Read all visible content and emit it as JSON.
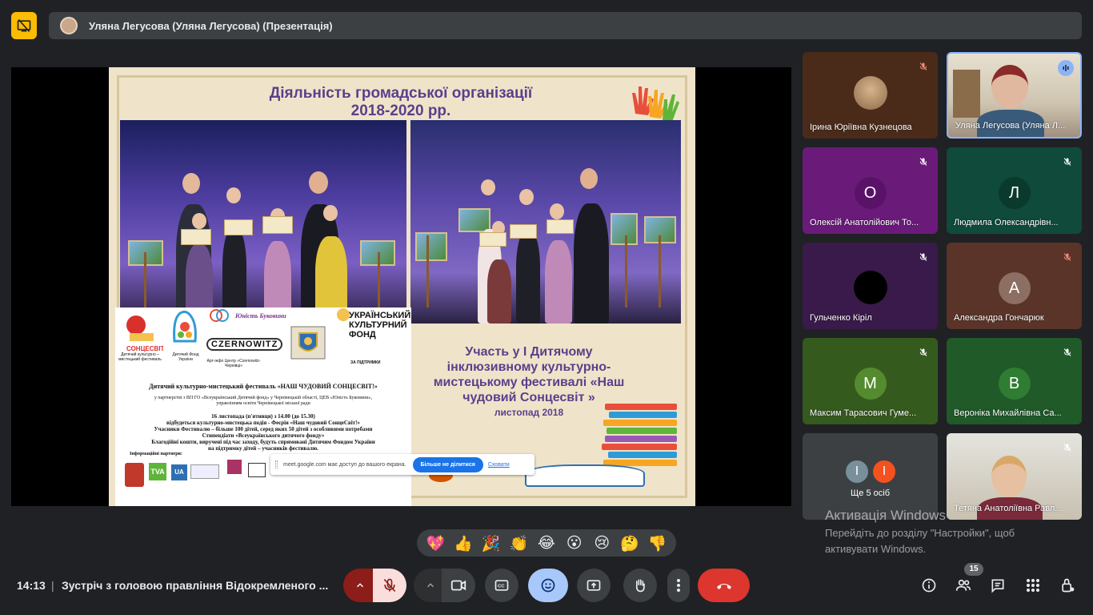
{
  "header": {
    "presenter_title": "Уляна Легусова (Уляна Легусова) (Презентація)"
  },
  "slide": {
    "title_line1": "Діяльність громадської організації",
    "title_line2": "2018-2020 рр.",
    "caption_line1": "Участь у І Дитячому",
    "caption_line2": "інклюзивному культурно-",
    "caption_line3": "мистецькому фестивалі «Наш",
    "caption_line4": "чудовий Сонцесвіт »",
    "caption_date": "листопад 2018",
    "flyer": {
      "logo1_caption": "Дитячий культурно – мистецький фестиваль",
      "logo2_caption": "Дитячий Фонд України",
      "logo3_caption": "Арт-інфо Центр «Czernowitz-Чернівці»",
      "cultural_fund": "УКРАЇНСЬКИЙ КУЛЬТУРНИЙ ФОНД",
      "support": "ЗА ПІДТРИМКИ",
      "unist_label": "Юність Буковини",
      "czernowitz": "CZERNOWITZ",
      "festival_title": "Дитячий культурно-мистецький фестиваль «НАШ ЧУДОВИЙ СОНЦЕСВІТ!»",
      "partners_line1": "у партнерстві з ВП ГО «Всеукраїнський Дитячий фонд» у Чернівецькій області, ЦЕВ «Юність Буковини»,",
      "partners_line2": "управлінням освіти Чернівецької міської ради",
      "date_line": "16 листопада (п'ятниця) з 14.00 (до 15.30)",
      "event_line": "відбудеться культурно-мистецька подія - Феєрія «Наш чудовий СонцеСвіт!»",
      "participants_line": "Учасники Фестивалю – більше 100 дітей, серед яких 50 дітей з особливими потребами",
      "scholars_line": "Стипендіати «Всеукраїнського дитячого фонду»",
      "charity_line": "Благодійні кошти, виручені під час заходу, будуть спрямовані Дитячим Фондом України",
      "charity_line2": "на підтримку дітей – учасників фестивалю.",
      "info_partners": "Інформаційні партнери:",
      "tva": "TVA",
      "ua": "UA"
    }
  },
  "share_banner": {
    "message": "meet.google.com має доступ до вашого екрана.",
    "stop_label": "Більше не ділитися",
    "hide_label": "Сховати"
  },
  "participants": [
    {
      "name": "Ірина Юріївна Кузнецова",
      "initial": ""
    },
    {
      "name": "Уляна Легусова (Уляна Л...",
      "initial": ""
    },
    {
      "name": "Олексій Анатолійович То...",
      "initial": "О"
    },
    {
      "name": "Людмила Олександрівн...",
      "initial": "Л"
    },
    {
      "name": "Гульченко Кіріл",
      "initial": ""
    },
    {
      "name": "Александра Гончарюк",
      "initial": "А"
    },
    {
      "name": "Максим Тарасович Гуме...",
      "initial": "М"
    },
    {
      "name": "Вероніка Михайлівна Са...",
      "initial": "В"
    },
    {
      "name": "Тетяна Анатоліївна Равл...",
      "initial": ""
    }
  ],
  "more_tile": {
    "label": "Ще 5 осіб",
    "initial1": "I",
    "initial2": "I"
  },
  "activation": {
    "title": "Активація Windows",
    "line1": "Перейдіть до розділу \"Настройки\", щоб",
    "line2": "активувати Windows."
  },
  "reactions": [
    "💖",
    "👍",
    "🎉",
    "👏",
    "😂",
    "😮",
    "😢",
    "🤔",
    "👎"
  ],
  "footer": {
    "time": "14:13",
    "separator": "|",
    "meeting_title": "Зустріч з головою правління Відокремленого ...",
    "participants_count": "15"
  },
  "colors": {
    "background": "#202124",
    "tile_grey": "#3c4043",
    "accent_blue": "#8ab4f8",
    "end_call_red": "#ea4335",
    "mic_off_red": "#8c1d18",
    "present_yellow": "#fbbc04"
  },
  "icons": [
    "present-off-icon",
    "mic-off-icon",
    "camera-icon",
    "captions-icon",
    "emoji-icon",
    "present-screen-icon",
    "raise-hand-icon",
    "more-options-icon",
    "end-call-icon",
    "info-icon",
    "people-icon",
    "chat-icon",
    "activities-icon",
    "host-controls-icon"
  ]
}
